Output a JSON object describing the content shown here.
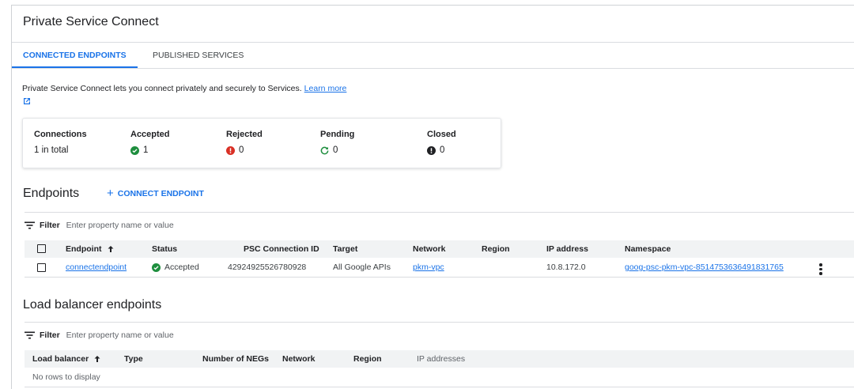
{
  "page": {
    "title": "Private Service Connect"
  },
  "tabs": [
    {
      "label": "CONNECTED ENDPOINTS",
      "active": true
    },
    {
      "label": "PUBLISHED SERVICES",
      "active": false
    }
  ],
  "description": {
    "text": "Private Service Connect lets you connect privately and securely to Services.",
    "link": "Learn more"
  },
  "summary": {
    "connections": {
      "label": "Connections",
      "value": "1 in total"
    },
    "accepted": {
      "label": "Accepted",
      "value": "1",
      "icon": "check-circle-icon",
      "color": "#1e8e3e"
    },
    "rejected": {
      "label": "Rejected",
      "value": "0",
      "icon": "error-circle-icon",
      "color": "#d93025"
    },
    "pending": {
      "label": "Pending",
      "value": "0",
      "icon": "refresh-icon",
      "color": "#1e8e3e"
    },
    "closed": {
      "label": "Closed",
      "value": "0",
      "icon": "info-circle-icon",
      "color": "#202124"
    }
  },
  "endpoints": {
    "title": "Endpoints",
    "connect_button": "CONNECT ENDPOINT",
    "filter_label": "Filter",
    "filter_placeholder": "Enter property name or value",
    "columns": [
      "Endpoint",
      "Status",
      "PSC Connection ID",
      "Target",
      "Network",
      "Region",
      "IP address",
      "Namespace"
    ],
    "rows": [
      {
        "endpoint": "connectendpoint",
        "status": "Accepted",
        "psc_connection_id": "42924925526780928",
        "target": "All Google APIs",
        "network": "pkm-vpc",
        "region": "",
        "ip_address": "10.8.172.0",
        "namespace": "goog-psc-pkm-vpc-8514753636491831765"
      }
    ]
  },
  "load_balancer": {
    "title": "Load balancer endpoints",
    "filter_label": "Filter",
    "filter_placeholder": "Enter property name or value",
    "columns": [
      "Load balancer",
      "Type",
      "Number of NEGs",
      "Network",
      "Region",
      "IP addresses"
    ],
    "empty_text": "No rows to display"
  },
  "colors": {
    "accent": "#1a73e8",
    "success": "#1e8e3e",
    "error": "#d93025"
  }
}
